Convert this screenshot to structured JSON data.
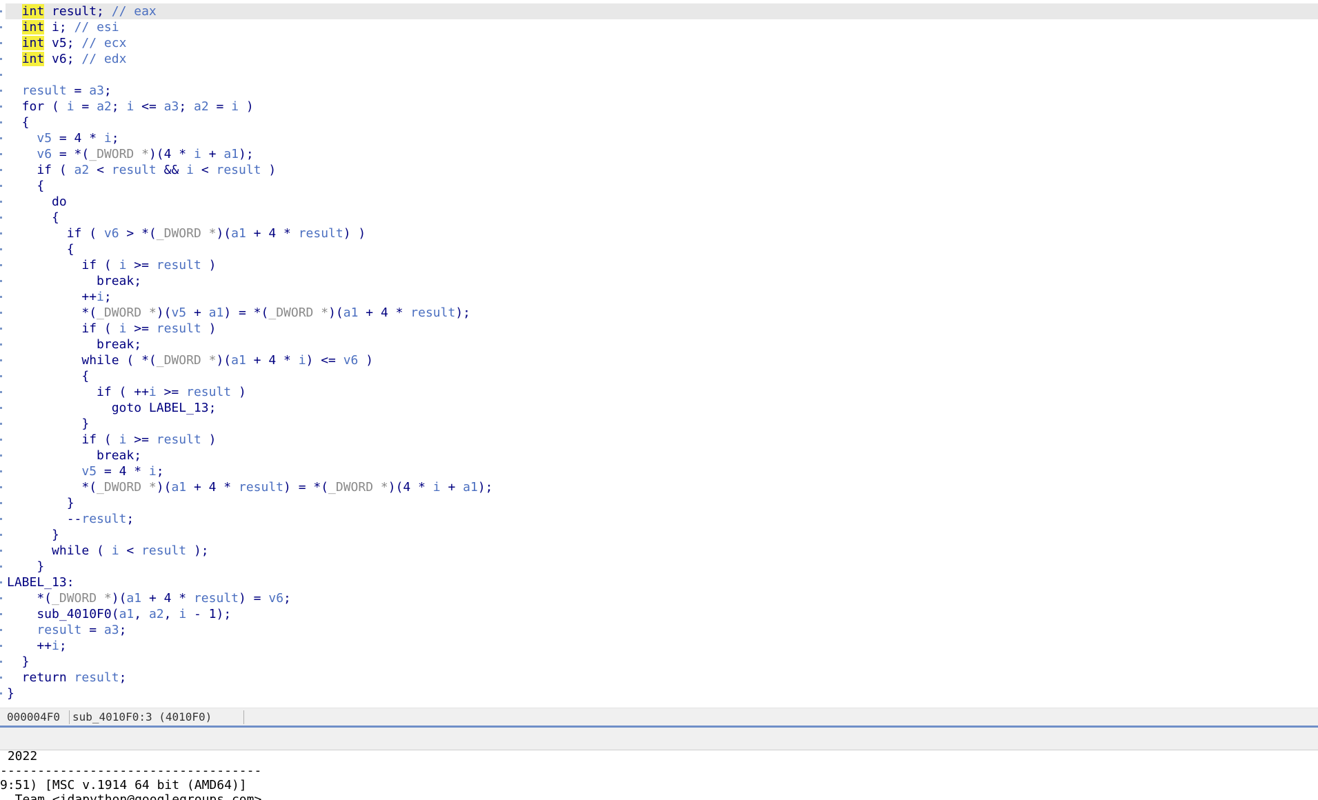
{
  "editor": {
    "lines": [
      [
        {
          "t": "  "
        },
        {
          "t": "int",
          "c": "hi"
        },
        {
          "t": " result; "
        },
        {
          "t": "// eax",
          "c": "cmt"
        }
      ],
      [
        {
          "t": "  "
        },
        {
          "t": "int",
          "c": "hi"
        },
        {
          "t": " i; "
        },
        {
          "t": "// esi",
          "c": "cmt"
        }
      ],
      [
        {
          "t": "  "
        },
        {
          "t": "int",
          "c": "hi"
        },
        {
          "t": " v5; "
        },
        {
          "t": "// ecx",
          "c": "cmt"
        }
      ],
      [
        {
          "t": "  "
        },
        {
          "t": "int",
          "c": "hi"
        },
        {
          "t": " v6; "
        },
        {
          "t": "// edx",
          "c": "cmt"
        }
      ],
      [],
      [
        {
          "t": "  "
        },
        {
          "t": "result",
          "c": "var"
        },
        {
          "t": " = "
        },
        {
          "t": "a3",
          "c": "var"
        },
        {
          "t": ";"
        }
      ],
      [
        {
          "t": "  for ( "
        },
        {
          "t": "i",
          "c": "var"
        },
        {
          "t": " = "
        },
        {
          "t": "a2",
          "c": "var"
        },
        {
          "t": "; "
        },
        {
          "t": "i",
          "c": "var"
        },
        {
          "t": " <= "
        },
        {
          "t": "a3",
          "c": "var"
        },
        {
          "t": "; "
        },
        {
          "t": "a2",
          "c": "var"
        },
        {
          "t": " = "
        },
        {
          "t": "i",
          "c": "var"
        },
        {
          "t": " )"
        }
      ],
      [
        {
          "t": "  {"
        }
      ],
      [
        {
          "t": "    "
        },
        {
          "t": "v5",
          "c": "var"
        },
        {
          "t": " = 4 * "
        },
        {
          "t": "i",
          "c": "var"
        },
        {
          "t": ";"
        }
      ],
      [
        {
          "t": "    "
        },
        {
          "t": "v6",
          "c": "var"
        },
        {
          "t": " = *("
        },
        {
          "t": "_DWORD *",
          "c": "typ"
        },
        {
          "t": ")(4 * "
        },
        {
          "t": "i",
          "c": "var"
        },
        {
          "t": " + "
        },
        {
          "t": "a1",
          "c": "var"
        },
        {
          "t": ");"
        }
      ],
      [
        {
          "t": "    if ( "
        },
        {
          "t": "a2",
          "c": "var"
        },
        {
          "t": " < "
        },
        {
          "t": "result",
          "c": "var"
        },
        {
          "t": " && "
        },
        {
          "t": "i",
          "c": "var"
        },
        {
          "t": " < "
        },
        {
          "t": "result",
          "c": "var"
        },
        {
          "t": " )"
        }
      ],
      [
        {
          "t": "    {"
        }
      ],
      [
        {
          "t": "      do"
        }
      ],
      [
        {
          "t": "      {"
        }
      ],
      [
        {
          "t": "        if ( "
        },
        {
          "t": "v6",
          "c": "var"
        },
        {
          "t": " > *("
        },
        {
          "t": "_DWORD *",
          "c": "typ"
        },
        {
          "t": ")("
        },
        {
          "t": "a1",
          "c": "var"
        },
        {
          "t": " + 4 * "
        },
        {
          "t": "result",
          "c": "var"
        },
        {
          "t": ") )"
        }
      ],
      [
        {
          "t": "        {"
        }
      ],
      [
        {
          "t": "          if ( "
        },
        {
          "t": "i",
          "c": "var"
        },
        {
          "t": " >= "
        },
        {
          "t": "result",
          "c": "var"
        },
        {
          "t": " )"
        }
      ],
      [
        {
          "t": "            break;"
        }
      ],
      [
        {
          "t": "          ++"
        },
        {
          "t": "i",
          "c": "var"
        },
        {
          "t": ";"
        }
      ],
      [
        {
          "t": "          *("
        },
        {
          "t": "_DWORD *",
          "c": "typ"
        },
        {
          "t": ")("
        },
        {
          "t": "v5",
          "c": "var"
        },
        {
          "t": " + "
        },
        {
          "t": "a1",
          "c": "var"
        },
        {
          "t": ") = *("
        },
        {
          "t": "_DWORD *",
          "c": "typ"
        },
        {
          "t": ")("
        },
        {
          "t": "a1",
          "c": "var"
        },
        {
          "t": " + 4 * "
        },
        {
          "t": "result",
          "c": "var"
        },
        {
          "t": ");"
        }
      ],
      [
        {
          "t": "          if ( "
        },
        {
          "t": "i",
          "c": "var"
        },
        {
          "t": " >= "
        },
        {
          "t": "result",
          "c": "var"
        },
        {
          "t": " )"
        }
      ],
      [
        {
          "t": "            break;"
        }
      ],
      [
        {
          "t": "          while ( *("
        },
        {
          "t": "_DWORD *",
          "c": "typ"
        },
        {
          "t": ")("
        },
        {
          "t": "a1",
          "c": "var"
        },
        {
          "t": " + 4 * "
        },
        {
          "t": "i",
          "c": "var"
        },
        {
          "t": ") <= "
        },
        {
          "t": "v6",
          "c": "var"
        },
        {
          "t": " )"
        }
      ],
      [
        {
          "t": "          {"
        }
      ],
      [
        {
          "t": "            if ( ++"
        },
        {
          "t": "i",
          "c": "var"
        },
        {
          "t": " >= "
        },
        {
          "t": "result",
          "c": "var"
        },
        {
          "t": " )"
        }
      ],
      [
        {
          "t": "              goto LABEL_13;"
        }
      ],
      [
        {
          "t": "          }"
        }
      ],
      [
        {
          "t": "          if ( "
        },
        {
          "t": "i",
          "c": "var"
        },
        {
          "t": " >= "
        },
        {
          "t": "result",
          "c": "var"
        },
        {
          "t": " )"
        }
      ],
      [
        {
          "t": "            break;"
        }
      ],
      [
        {
          "t": "          "
        },
        {
          "t": "v5",
          "c": "var"
        },
        {
          "t": " = 4 * "
        },
        {
          "t": "i",
          "c": "var"
        },
        {
          "t": ";"
        }
      ],
      [
        {
          "t": "          *("
        },
        {
          "t": "_DWORD *",
          "c": "typ"
        },
        {
          "t": ")("
        },
        {
          "t": "a1",
          "c": "var"
        },
        {
          "t": " + 4 * "
        },
        {
          "t": "result",
          "c": "var"
        },
        {
          "t": ") = *("
        },
        {
          "t": "_DWORD *",
          "c": "typ"
        },
        {
          "t": ")(4 * "
        },
        {
          "t": "i",
          "c": "var"
        },
        {
          "t": " + "
        },
        {
          "t": "a1",
          "c": "var"
        },
        {
          "t": ");"
        }
      ],
      [
        {
          "t": "        }"
        }
      ],
      [
        {
          "t": "        --"
        },
        {
          "t": "result",
          "c": "var"
        },
        {
          "t": ";"
        }
      ],
      [
        {
          "t": "      }"
        }
      ],
      [
        {
          "t": "      while ( "
        },
        {
          "t": "i",
          "c": "var"
        },
        {
          "t": " < "
        },
        {
          "t": "result",
          "c": "var"
        },
        {
          "t": " );"
        }
      ],
      [
        {
          "t": "    }"
        }
      ],
      [
        {
          "t": "LABEL_13:"
        }
      ],
      [
        {
          "t": "    *("
        },
        {
          "t": "_DWORD *",
          "c": "typ"
        },
        {
          "t": ")("
        },
        {
          "t": "a1",
          "c": "var"
        },
        {
          "t": " + 4 * "
        },
        {
          "t": "result",
          "c": "var"
        },
        {
          "t": ") = "
        },
        {
          "t": "v6",
          "c": "var"
        },
        {
          "t": ";"
        }
      ],
      [
        {
          "t": "    sub_4010F0("
        },
        {
          "t": "a1",
          "c": "var"
        },
        {
          "t": ", "
        },
        {
          "t": "a2",
          "c": "var"
        },
        {
          "t": ", "
        },
        {
          "t": "i",
          "c": "var"
        },
        {
          "t": " - 1);"
        }
      ],
      [
        {
          "t": "    "
        },
        {
          "t": "result",
          "c": "var"
        },
        {
          "t": " = "
        },
        {
          "t": "a3",
          "c": "var"
        },
        {
          "t": ";"
        }
      ],
      [
        {
          "t": "    ++"
        },
        {
          "t": "i",
          "c": "var"
        },
        {
          "t": ";"
        }
      ],
      [
        {
          "t": "  }"
        }
      ],
      [
        {
          "t": "  return "
        },
        {
          "t": "result",
          "c": "var"
        },
        {
          "t": ";"
        }
      ],
      [
        {
          "t": "}"
        }
      ]
    ]
  },
  "status_bar": {
    "address": "000004F0",
    "location": "sub_4010F0:3 (4010F0)"
  },
  "output": {
    "lines": [
      " 2022",
      "-----------------------------------",
      "9:51) [MSC v.1914 64 bit (AMD64)]",
      "  Team <idapython@googlegroups.com>"
    ]
  },
  "colors": {
    "identifier": "#4b6fc0",
    "keyword_text": "#000080",
    "type_cast": "#8a8a8a",
    "highlight": "#f5ef3e",
    "selected_line": "#e8e8e8"
  }
}
